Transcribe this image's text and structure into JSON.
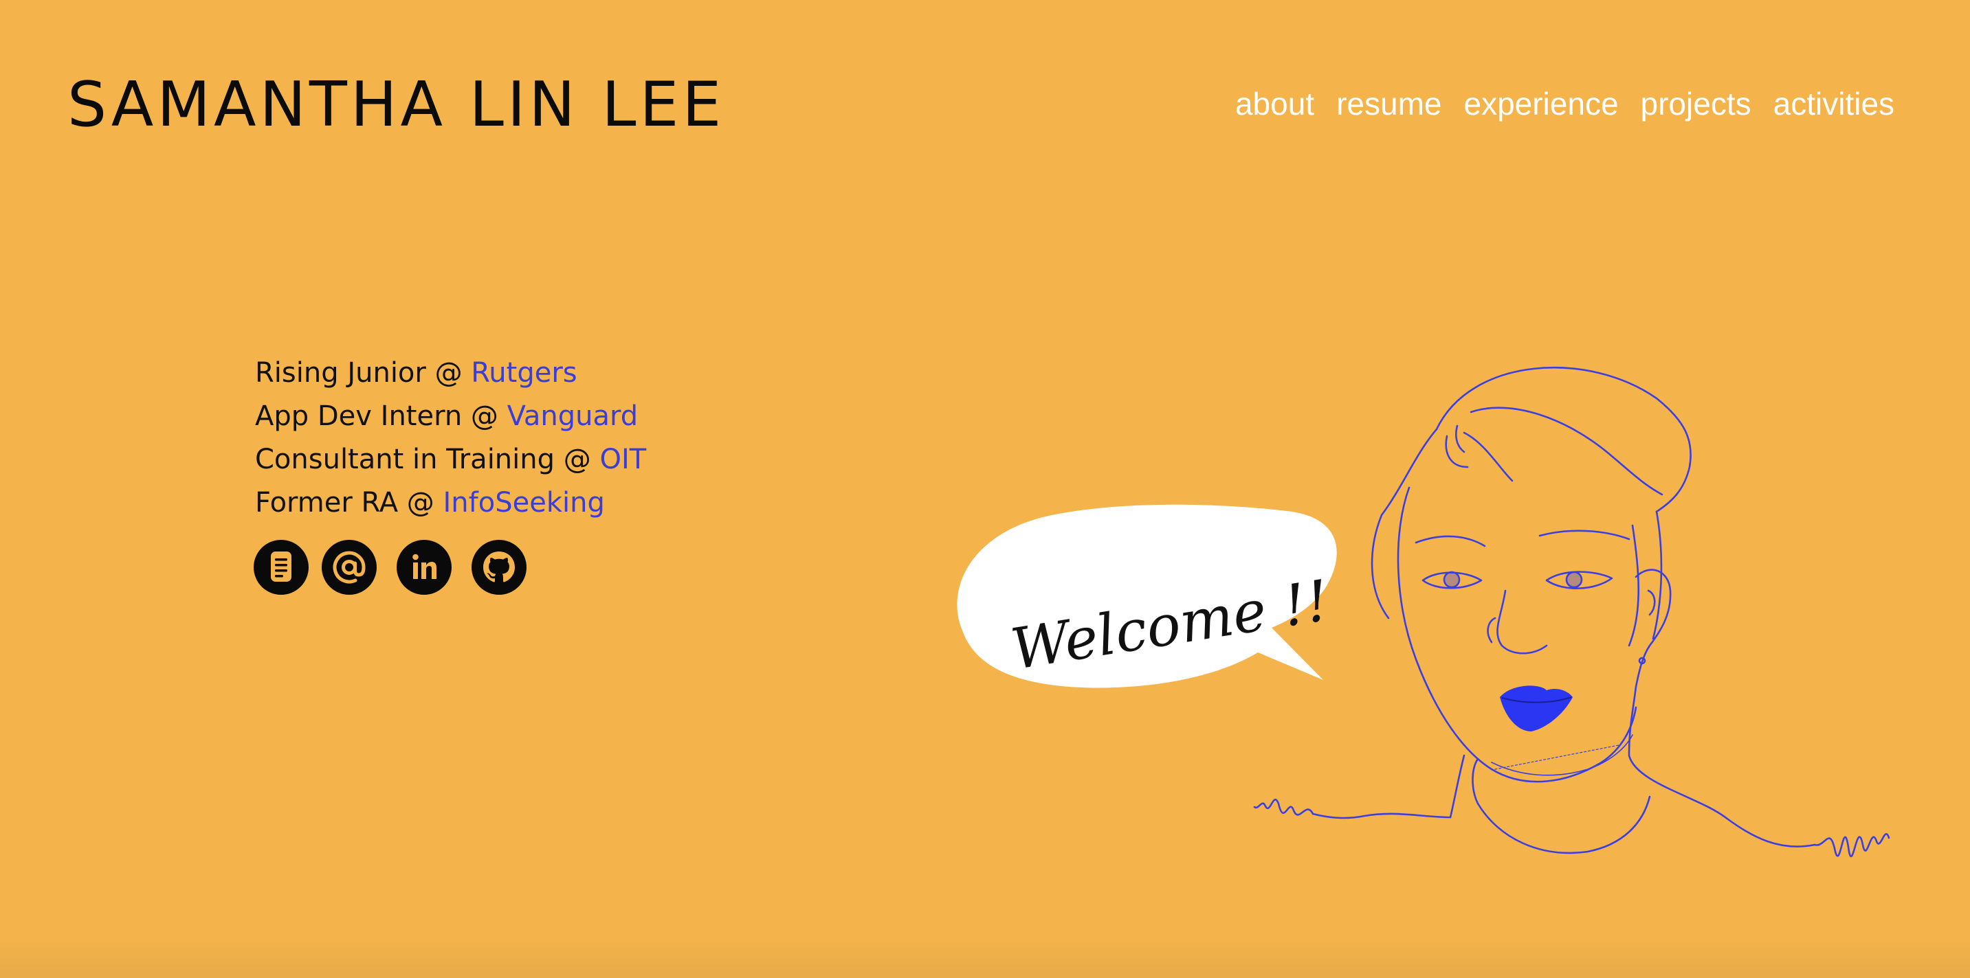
{
  "header": {
    "title": "SAMANTHA LIN LEE",
    "nav": [
      "about",
      "resume",
      "experience",
      "projects",
      "activities"
    ]
  },
  "bio": [
    {
      "prefix": "Rising Junior @ ",
      "link": "Rutgers"
    },
    {
      "prefix": "App Dev Intern @ ",
      "link": "Vanguard"
    },
    {
      "prefix": "Consultant in Training @ ",
      "link": "OIT"
    },
    {
      "prefix": "Former RA @ ",
      "link": "InfoSeeking"
    }
  ],
  "socials": [
    "resume-icon",
    "email-icon",
    "linkedin-icon",
    "github-icon"
  ],
  "illustration": {
    "speech_bubble_text": "Welcome !!"
  },
  "colors": {
    "background": "#F4B44B",
    "link": "#3A3ED6",
    "nav": "#FFFFFF",
    "title": "#0B0B0B",
    "line_art": "#3B3FE0"
  }
}
